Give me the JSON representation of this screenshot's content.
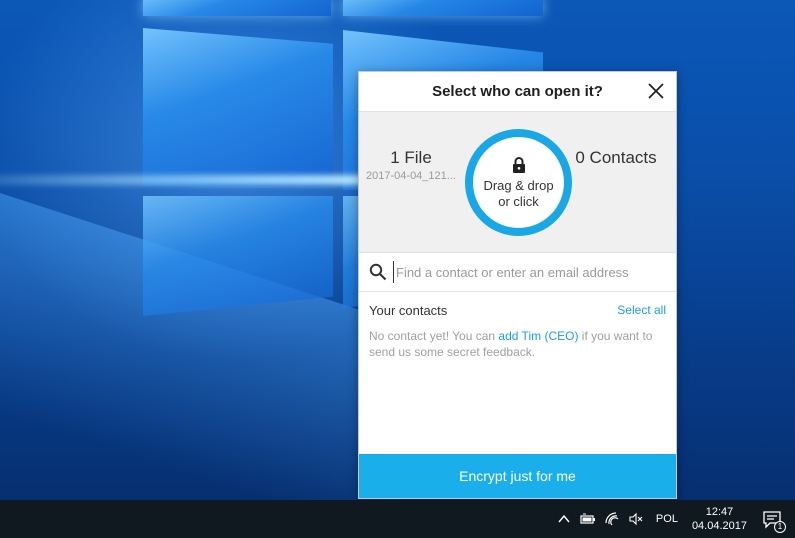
{
  "dialog": {
    "title": "Select who can open it?",
    "close_icon": "close-icon"
  },
  "drop_zone": {
    "files_count": "1 File",
    "file_name": "2017-04-04_121...",
    "contacts_count": "0 Contacts",
    "drop_line1": "Drag & drop",
    "drop_line2": "or click",
    "lock_icon": "lock-icon",
    "ring_color": "#1aa7e6"
  },
  "search": {
    "placeholder": "Find a contact or enter an email address",
    "value": "",
    "icon": "search-icon"
  },
  "contacts": {
    "title": "Your contacts",
    "select_all": "Select all",
    "empty_prefix": "No contact yet! You can ",
    "empty_link": "add Tim (CEO)",
    "empty_suffix": " if you want to send us some secret feedback."
  },
  "footer": {
    "encrypt_label": "Encrypt just for me",
    "button_color": "#1aaeea"
  },
  "taskbar": {
    "tray_icons": [
      "chevron-up-icon",
      "battery-icon",
      "wifi-icon",
      "speaker-muted-icon"
    ],
    "language": "POL",
    "time": "12:47",
    "date": "04.04.2017",
    "notification_count": "1",
    "notification_icon": "action-center-icon"
  }
}
